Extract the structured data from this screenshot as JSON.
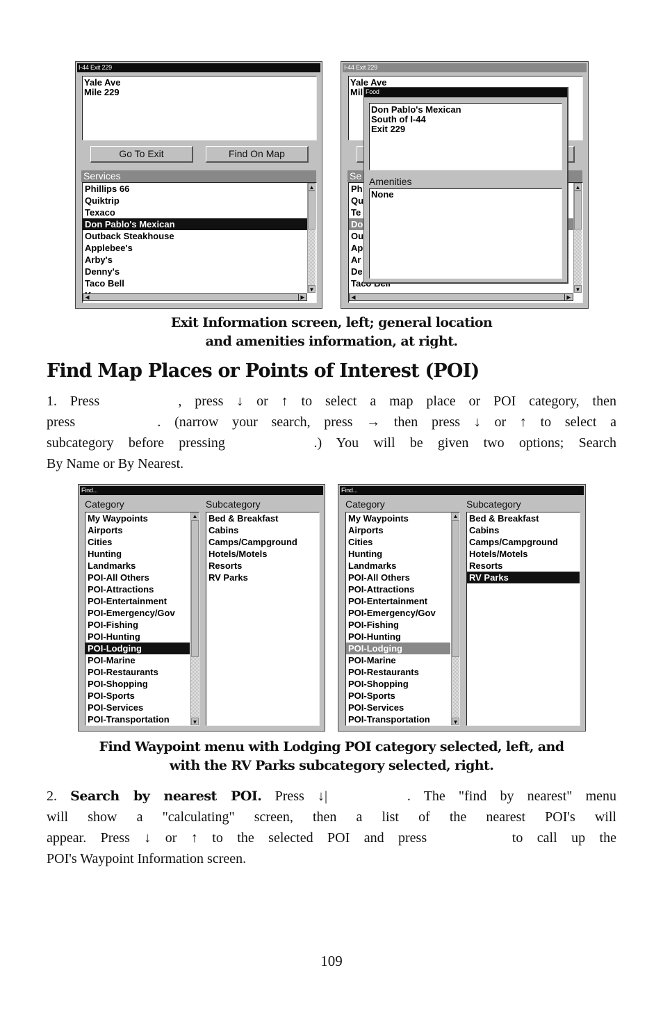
{
  "exit_info_left": {
    "title": "I-44 Exit 229",
    "info_lines": [
      "Yale Ave",
      "Mile 229"
    ],
    "buttons": {
      "go_to_exit": "Go To Exit",
      "find_on_map": "Find On Map"
    },
    "services_header": "Services",
    "services": [
      "Phillips 66",
      "Quiktrip",
      "Texaco",
      "Don Pablo's Mexican",
      "Outback Steakhouse",
      "Applebee's",
      "Arby's",
      "Denny's",
      "Taco Bell"
    ],
    "selected_service": "Don Pablo's Mexican"
  },
  "exit_info_right": {
    "title": "I-44 Exit 229",
    "info_lines_partial": [
      "Yale Ave",
      "Mil"
    ],
    "services_header_partial": "Se",
    "services_partial": [
      "Ph",
      "Qu",
      "Te",
      "Do",
      "Ou",
      "Ap",
      "Ar",
      "De"
    ],
    "services_tail": "Taco Bell",
    "popup": {
      "title": "Food",
      "details": [
        "Don Pablo's Mexican",
        "South of I-44",
        "Exit 229"
      ],
      "amenities_header": "Amenities",
      "amenities_value": "None"
    }
  },
  "caption1": {
    "line1": "Exit Information screen, left; general location",
    "line2": "and amenities information, at right."
  },
  "heading": "Find Map Places or Points of Interest (POI)",
  "para1": {
    "line1": "1. Press      , press ↓ or ↑ to select a map place or POI category, then",
    "line2": "press      . (narrow your search, press → then press ↓ or ↑ to select a",
    "line3": "subcategory before pressing      .) You will be given two options; Search",
    "line4": "By Name or By Nearest."
  },
  "find_left": {
    "title": "Find...",
    "category_label": "Category",
    "subcategory_label": "Subcategory",
    "categories": [
      "My Waypoints",
      "Airports",
      "Cities",
      "Hunting",
      "Landmarks",
      "POI-All Others",
      "POI-Attractions",
      "POI-Entertainment",
      "POI-Emergency/Gov",
      "POI-Fishing",
      "POI-Hunting",
      "POI-Lodging",
      "POI-Marine",
      "POI-Restaurants",
      "POI-Shopping",
      "POI-Sports",
      "POI-Services",
      "POI-Transportation"
    ],
    "selected_category": "POI-Lodging",
    "subcategories": [
      "Bed & Breakfast",
      "Cabins",
      "Camps/Campground",
      "Hotels/Motels",
      "Resorts",
      "RV Parks"
    ],
    "selected_subcategory": null
  },
  "find_right": {
    "title": "Find...",
    "category_label": "Category",
    "subcategory_label": "Subcategory",
    "categories": [
      "My Waypoints",
      "Airports",
      "Cities",
      "Hunting",
      "Landmarks",
      "POI-All Others",
      "POI-Attractions",
      "POI-Entertainment",
      "POI-Emergency/Gov",
      "POI-Fishing",
      "POI-Hunting",
      "POI-Lodging",
      "POI-Marine",
      "POI-Restaurants",
      "POI-Shopping",
      "POI-Sports",
      "POI-Services",
      "POI-Transportation"
    ],
    "selected_category": "POI-Lodging",
    "subcategories": [
      "Bed & Breakfast",
      "Cabins",
      "Camps/Campground",
      "Hotels/Motels",
      "Resorts",
      "RV Parks"
    ],
    "selected_subcategory": "RV Parks"
  },
  "caption2": {
    "line1": "Find Waypoint menu with Lodging POI category selected, left, and",
    "line2": "with the RV Parks subcategory selected, right."
  },
  "para2": {
    "number": "2. ",
    "bold": "Search by nearest POI.",
    "line1_rest": " Press ↓|      . The \"find by nearest\" menu",
    "line2": "will show a \"calculating\" screen, then a list of the nearest POI's will",
    "line3": "appear. Press ↓ or ↑ to the selected POI and press      to call up the",
    "line4": "POI's Waypoint Information screen."
  },
  "page_number": "109",
  "icons": {
    "scroll_up": "▲",
    "scroll_down": "▼",
    "scroll_left": "◀",
    "scroll_right": "▶"
  }
}
